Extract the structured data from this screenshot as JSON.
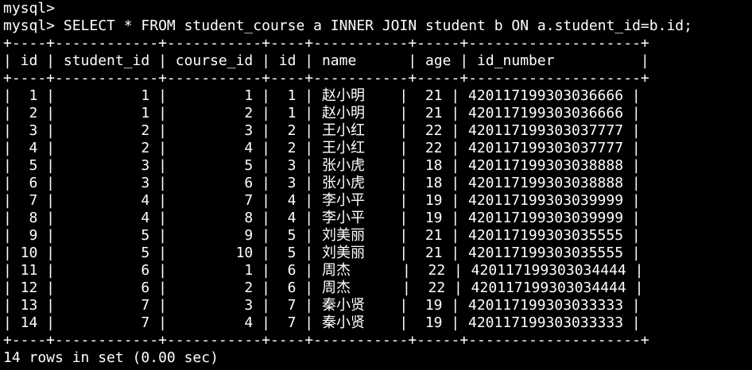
{
  "terminal": {
    "prompt1": "mysql>",
    "prompt2": "mysql> SELECT * FROM student_course a INNER JOIN student b ON a.student_id=b.id;",
    "separator": "+----+------------+-----------+----+-----------+-----+--------------------+",
    "header": "| id | student_id | course_id | id | name      | age | id_number          |",
    "rows": [
      "|  1 |          1 |         1 |  1 | 赵小明    |  21 | 420117199303036666 |",
      "|  2 |          1 |         2 |  1 | 赵小明    |  21 | 420117199303036666 |",
      "|  3 |          2 |         3 |  2 | 王小红    |  22 | 420117199303037777 |",
      "|  4 |          2 |         4 |  2 | 王小红    |  22 | 420117199303037777 |",
      "|  5 |          3 |         5 |  3 | 张小虎    |  18 | 420117199303038888 |",
      "|  6 |          3 |         6 |  3 | 张小虎    |  18 | 420117199303038888 |",
      "|  7 |          4 |         7 |  4 | 李小平    |  19 | 420117199303039999 |",
      "|  8 |          4 |         8 |  4 | 李小平    |  19 | 420117199303039999 |",
      "|  9 |          5 |         9 |  5 | 刘美丽    |  21 | 420117199303035555 |",
      "| 10 |          5 |        10 |  5 | 刘美丽    |  21 | 420117199303035555 |",
      "| 11 |          6 |         1 |  6 | 周杰      |  22 | 420117199303034444 |",
      "| 12 |          6 |         2 |  6 | 周杰      |  22 | 420117199303034444 |",
      "| 13 |          7 |         3 |  7 | 秦小贤    |  19 | 420117199303033333 |",
      "| 14 |          7 |         4 |  7 | 秦小贤    |  19 | 420117199303033333 |"
    ],
    "footer": "14 rows in set (0.00 sec)"
  },
  "colors": {
    "background": "#000000",
    "foreground": "#ffffff"
  }
}
